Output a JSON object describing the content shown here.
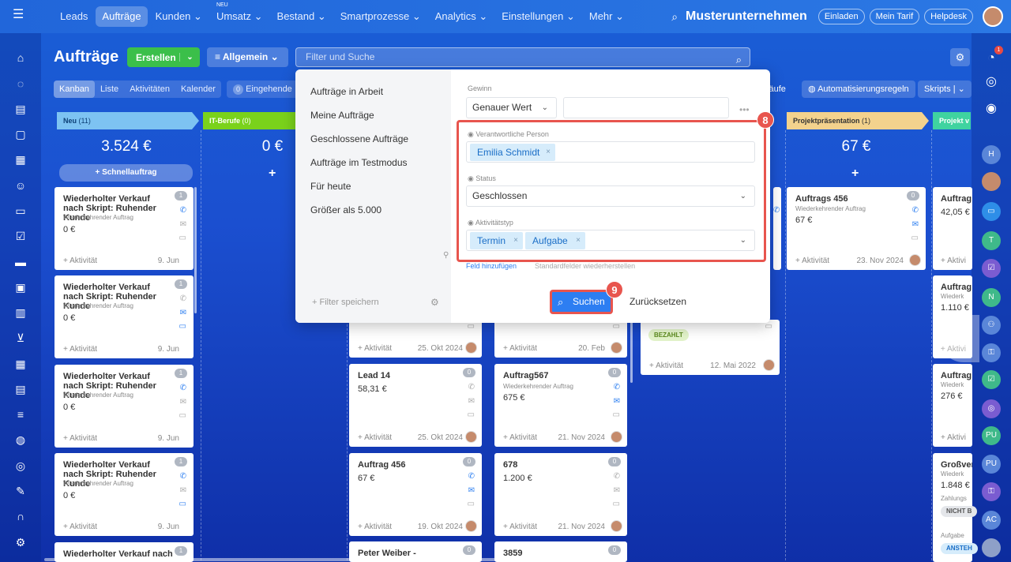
{
  "topnav": {
    "items": [
      "Leads",
      "Aufträge",
      "Kunden",
      "Umsatz",
      "Bestand",
      "Smartprozesse",
      "Analytics",
      "Einstellungen",
      "Mehr"
    ],
    "new_badge": "NEU",
    "company": "Musterunternehmen",
    "buttons": [
      "Einladen",
      "Mein Tarif",
      "Helpdesk"
    ]
  },
  "header": {
    "title": "Aufträge",
    "create_label": "Erstellen",
    "preset_label": "Allgemein",
    "search_placeholder": "Filter und Suche"
  },
  "viewtabs": [
    "Kanban",
    "Liste",
    "Aktivitäten",
    "Kalender"
  ],
  "eingehende": {
    "count": "0",
    "label": "Eingehende"
  },
  "right_buttons": [
    "käufe",
    "Automatisierungsregeln",
    "Skripts"
  ],
  "columns": [
    {
      "name": "Neu",
      "count": "(11)",
      "sum": "3.524 €",
      "color": "#7dc3f2"
    },
    {
      "name": "IT-Berufe",
      "count": "(0)",
      "sum": "0 €",
      "color": "#7ad21b"
    },
    {
      "name": "Projektpräsentation",
      "count": "(1)",
      "sum": "67 €",
      "color": "#f3d28d"
    },
    {
      "name": "Projekt v",
      "color": "#3fd3a0"
    }
  ],
  "quick_add": "Schnellauftrag",
  "cards_col1": [
    {
      "title": "Wiederholter Verkauf nach Skript: Ruhender Kunde",
      "sub": "Wiederkehrender Auftrag",
      "amount": "0 €",
      "activity": "+ Aktivität",
      "date": "9. Jun",
      "badge": "1"
    },
    {
      "title": "Wiederholter Verkauf nach Skript: Ruhender Kunde",
      "sub": "Wiederkehrender Auftrag",
      "amount": "0 €",
      "activity": "+ Aktivität",
      "date": "9. Jun",
      "badge": "1"
    },
    {
      "title": "Wiederholter Verkauf nach Skript: Ruhender Kunde",
      "sub": "Wiederkehrender Auftrag",
      "amount": "0 €",
      "activity": "+ Aktivität",
      "date": "9. Jun",
      "badge": "1"
    },
    {
      "title": "Wiederholter Verkauf nach Skript: Ruhender Kunde",
      "sub": "Wiederkehrender Auftrag",
      "amount": "0 €",
      "activity": "+ Aktivität",
      "date": "9. Jun",
      "badge": "1"
    },
    {
      "title": "Wiederholter Verkauf nach",
      "badge": "1"
    }
  ],
  "cards_col3": [
    {
      "activity": "+ Aktivität",
      "date": "25. Okt 2024"
    },
    {
      "title": "Lead 14",
      "amount": "58,31 €",
      "activity": "+ Aktivität",
      "date": "25. Okt 2024",
      "badge": "0"
    },
    {
      "title": "Auftrag 456",
      "amount": "67 €",
      "activity": "+ Aktivität",
      "date": "19. Okt 2024",
      "badge": "0"
    },
    {
      "title": "Peter Weiber -",
      "badge": "0"
    }
  ],
  "cards_col4": [
    {
      "activity": "+ Aktivität",
      "date": "20. Feb"
    },
    {
      "title": "Auftrag567",
      "sub": "Wiederkehrender Auftrag",
      "amount": "675 €",
      "activity": "+ Aktivität",
      "date": "21. Nov 2024",
      "badge": "0"
    },
    {
      "title": "678",
      "amount": "1.200 €",
      "activity": "+ Aktivität",
      "date": "21. Nov 2024",
      "badge": "0"
    },
    {
      "title": "3859",
      "badge": "0"
    }
  ],
  "cards_col5": [
    {
      "paid": "BEZAHLT",
      "activity": "+ Aktivität",
      "date": "12. Mai 2022"
    }
  ],
  "cards_col6": [
    {
      "title": "Auftrags 456",
      "sub": "Wiederkehrender Auftrag",
      "amount": "67 €",
      "activity": "+ Aktivität",
      "date": "23. Nov 2024",
      "badge": "0"
    }
  ],
  "cards_col7": [
    {
      "title": "Auftrag",
      "amount": "42,05 €",
      "activity": "+ Aktivi"
    },
    {
      "title": "Auftrag",
      "sub": "Wiederk",
      "amount": "1.110 €",
      "activity": "+ Aktivi"
    },
    {
      "title": "Auftrag",
      "sub": "Wiederk",
      "amount": "276 €",
      "activity": "+ Aktivi"
    },
    {
      "title": "Großver",
      "sub": "Wiederk",
      "amount": "1.848 €",
      "extra": "Zahlungs",
      "badge_text": "NICHT B",
      "extra2": "Aufgabe",
      "badge2": "ANSTEH"
    }
  ],
  "filter": {
    "presets": [
      "Aufträge in Arbeit",
      "Meine Aufträge",
      "Geschlossene Aufträge",
      "Aufträge im Testmodus",
      "Für heute",
      "Größer als 5.000"
    ],
    "save_filter": "+ Filter speichern",
    "gewinn_label": "Gewinn",
    "gewinn_mode": "Genauer Wert",
    "resp_label": "Verantwortliche Person",
    "resp_value": "Emilia Schmidt",
    "status_label": "Status",
    "status_value": "Geschlossen",
    "activity_label": "Aktivitätstyp",
    "activity_values": [
      "Termin",
      "Aufgabe"
    ],
    "add_field": "Feld hinzufügen",
    "restore": "Standardfelder wiederherstellen",
    "search_btn": "Suchen",
    "reset_btn": "Zurücksetzen",
    "step8": "8",
    "step9": "9"
  },
  "rightbar": [
    "H",
    "T",
    "N",
    "PU",
    "PU",
    "AC"
  ],
  "notif_count": "1"
}
